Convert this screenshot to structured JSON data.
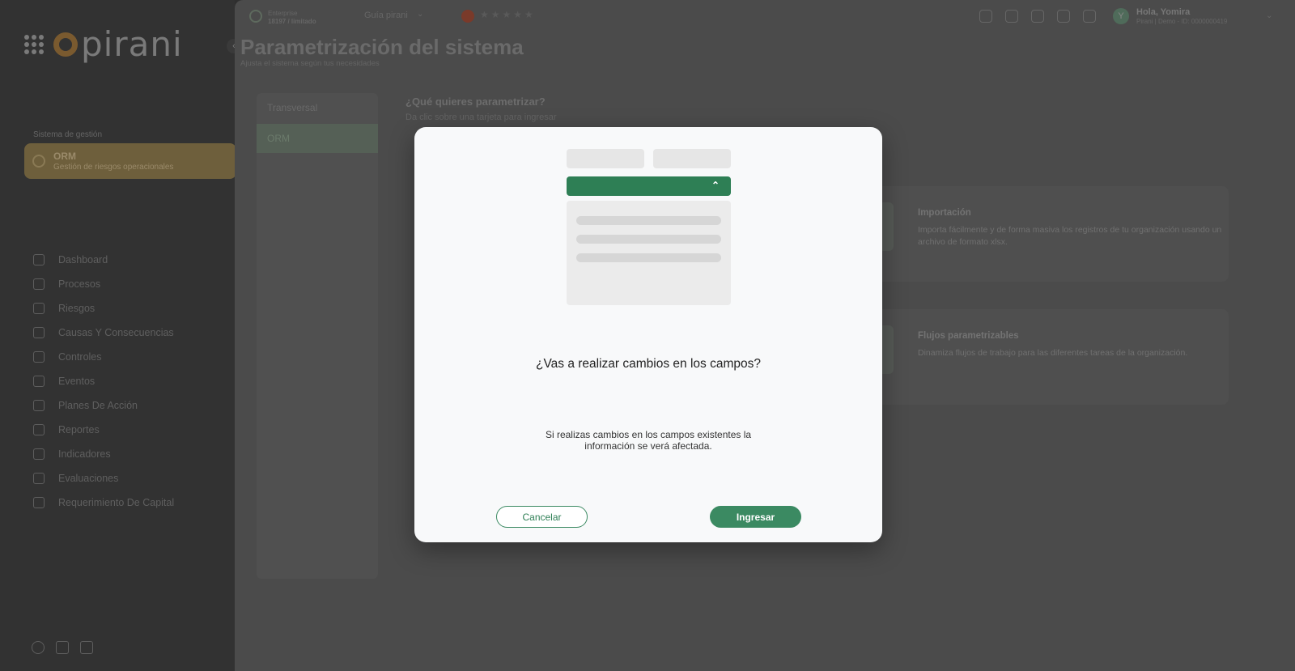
{
  "sidebar": {
    "logo_text": "pirani",
    "system_label": "Sistema de gestión",
    "active_module": {
      "title": "ORM",
      "subtitle": "Gestión de riesgos operacionales"
    },
    "items": [
      {
        "label": "Dashboard",
        "icon": "monitor-icon"
      },
      {
        "label": "Procesos",
        "icon": "list-icon"
      },
      {
        "label": "Riesgos",
        "icon": "alert-circle-icon"
      },
      {
        "label": "Causas Y Consecuencias",
        "icon": "bowtie-icon"
      },
      {
        "label": "Controles",
        "icon": "sliders-icon"
      },
      {
        "label": "Eventos",
        "icon": "warning-triangle-icon"
      },
      {
        "label": "Planes De Acción",
        "icon": "checkbox-icon"
      },
      {
        "label": "Reportes",
        "icon": "chart-icon"
      },
      {
        "label": "Indicadores",
        "icon": "crosshair-icon"
      },
      {
        "label": "Evaluaciones",
        "icon": "checklist-icon"
      },
      {
        "label": "Requerimiento De Capital",
        "icon": "dollar-circle-icon"
      }
    ]
  },
  "topbar": {
    "plan_line1": "Enterprise",
    "plan_line2": "18197 / limitado",
    "guide_label": "Guía pirani",
    "stars": "★★★★★",
    "user_initial": "Y",
    "greeting": "Hola, Yomira",
    "org": "Pirani | Demo - ID: 0000000419"
  },
  "page": {
    "title": "Parametrización del sistema",
    "subtitle": "Ajusta el sistema según tus necesidades",
    "tabs": [
      {
        "label": "Transversal"
      },
      {
        "label": "ORM"
      }
    ],
    "question_title": "¿Qué quieres parametrizar?",
    "question_sub": "Da clic sobre una tarjeta para ingresar",
    "cards": [
      {
        "title": "Importación",
        "description": "Importa fácilmente y de forma masiva los registros de tu organización usando un archivo de formato xlsx."
      },
      {
        "title": "Flujos parametrizables",
        "description": "Dinamiza flujos de trabajo para las diferentes tareas de la organización."
      }
    ]
  },
  "modal": {
    "title": "¿Vas a realizar cambios en los campos?",
    "text": "Si realizas cambios en los campos existentes la información se verá afectada.",
    "cancel_label": "Cancelar",
    "confirm_label": "Ingresar",
    "accent_color": "#2e7f55"
  }
}
